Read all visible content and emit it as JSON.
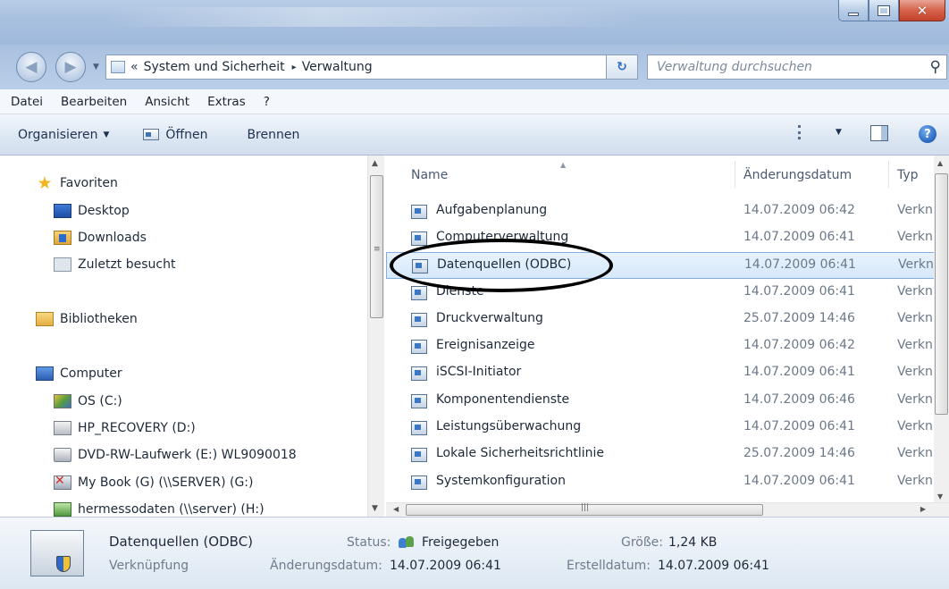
{
  "window": {
    "controls": {
      "minimize": "minimize-icon",
      "maximize": "maximize-icon",
      "close": "close-icon"
    }
  },
  "address": {
    "chevron": "«",
    "crumbs": [
      "System und Sicherheit",
      "Verwaltung"
    ],
    "separator": "▸",
    "search_placeholder": "Verwaltung durchsuchen"
  },
  "menu": {
    "items": [
      "Datei",
      "Bearbeiten",
      "Ansicht",
      "Extras",
      "?"
    ]
  },
  "toolbar": {
    "organize": "Organisieren",
    "open": "Öffnen",
    "burn": "Brennen"
  },
  "nav": {
    "favorites": "Favoriten",
    "desktop": "Desktop",
    "downloads": "Downloads",
    "recent": "Zuletzt besucht",
    "libraries": "Bibliotheken",
    "computer": "Computer",
    "drives": [
      "OS (C:)",
      "HP_RECOVERY (D:)",
      "DVD-RW-Laufwerk (E:) WL9090018",
      "My Book (G) (\\\\SERVER) (G:)",
      "hermessodaten (\\\\server) (H:)"
    ]
  },
  "columns": {
    "name": "Name",
    "date": "Änderungsdatum",
    "type": "Typ"
  },
  "files": [
    {
      "name": "Aufgabenplanung",
      "date": "14.07.2009 06:42",
      "type": "Verkn"
    },
    {
      "name": "Computerverwaltung",
      "date": "14.07.2009 06:41",
      "type": "Verkn"
    },
    {
      "name": "Datenquellen (ODBC)",
      "date": "14.07.2009 06:41",
      "type": "Verkn"
    },
    {
      "name": "Dienste",
      "date": "14.07.2009 06:41",
      "type": "Verkn"
    },
    {
      "name": "Druckverwaltung",
      "date": "25.07.2009 14:46",
      "type": "Verkn"
    },
    {
      "name": "Ereignisanzeige",
      "date": "14.07.2009 06:42",
      "type": "Verkn"
    },
    {
      "name": "iSCSI-Initiator",
      "date": "14.07.2009 06:41",
      "type": "Verkn"
    },
    {
      "name": "Komponentendienste",
      "date": "14.07.2009 06:46",
      "type": "Verkn"
    },
    {
      "name": "Leistungsüberwachung",
      "date": "14.07.2009 06:41",
      "type": "Verkn"
    },
    {
      "name": "Lokale Sicherheitsrichtlinie",
      "date": "25.07.2009 14:46",
      "type": "Verkn"
    },
    {
      "name": "Systemkonfiguration",
      "date": "14.07.2009 06:41",
      "type": "Verkn"
    }
  ],
  "selected_index": 2,
  "details": {
    "name": "Datenquellen (ODBC)",
    "kind": "Verknüpfung",
    "status_label": "Status:",
    "status_value": "Freigegeben",
    "modified_label": "Änderungsdatum:",
    "modified_value": "14.07.2009 06:41",
    "size_label": "Größe:",
    "size_value": "1,24 KB",
    "created_label": "Erstelldatum:",
    "created_value": "14.07.2009 06:41"
  }
}
